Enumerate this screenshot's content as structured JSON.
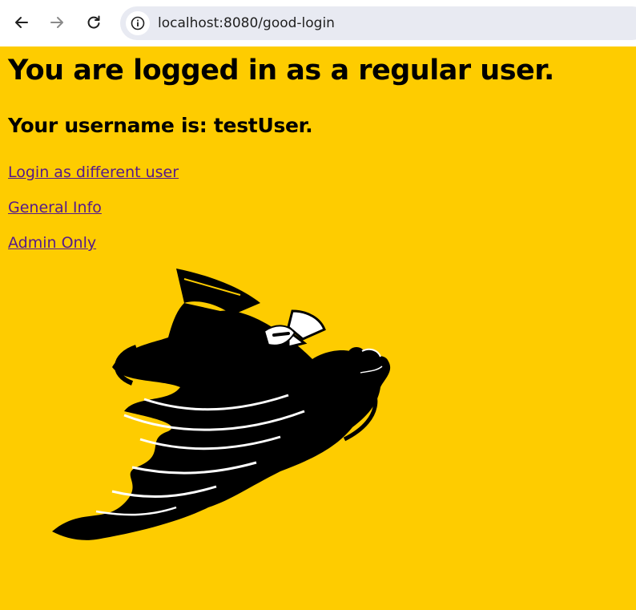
{
  "browser": {
    "url": "localhost:8080/good-login",
    "icons": {
      "back": "back-arrow-icon",
      "forward": "forward-arrow-icon",
      "reload": "reload-icon",
      "site_info": "info-icon"
    }
  },
  "page": {
    "heading": "You are logged in as a regular user.",
    "subheading": "Your username is: testUser.",
    "links": [
      "Login as different user",
      "General Info",
      "Admin Only"
    ],
    "mascot": "cardinal-tornado-mascot"
  },
  "colors": {
    "background": "#fecc00",
    "link": "#551a8b",
    "text": "#000000",
    "omnibox": "#e8eaf2"
  }
}
